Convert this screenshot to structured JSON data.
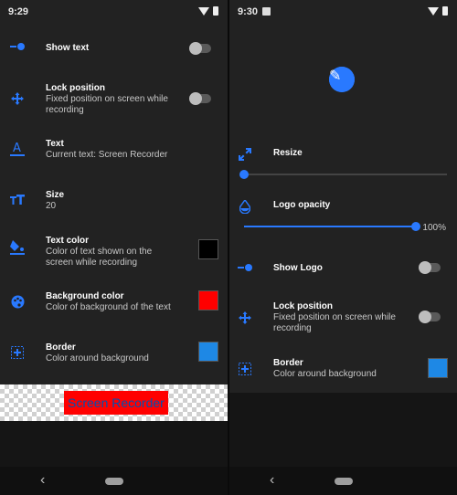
{
  "left": {
    "time": "9:29",
    "items": [
      {
        "title": "Show text",
        "subtitle": ""
      },
      {
        "title": "Lock position",
        "subtitle": "Fixed position on screen while recording"
      },
      {
        "title": "Text",
        "subtitle": "Current text: Screen Recorder"
      },
      {
        "title": "Size",
        "subtitle": "20"
      },
      {
        "title": "Text color",
        "subtitle": "Color of text shown on the screen while recording"
      },
      {
        "title": "Background color",
        "subtitle": "Color of background of the text"
      },
      {
        "title": "Border",
        "subtitle": "Color around background"
      }
    ],
    "swatches": {
      "text_color": "#000000",
      "background_color": "#ff0000",
      "border_color": "#1e88e5"
    },
    "preview_text": "Screen Recorder"
  },
  "right": {
    "time": "9:30",
    "items": [
      {
        "title": "Resize",
        "subtitle": ""
      },
      {
        "title": "Logo opacity",
        "subtitle": ""
      },
      {
        "title": "Show Logo",
        "subtitle": ""
      },
      {
        "title": "Lock position",
        "subtitle": "Fixed position on screen while recording"
      },
      {
        "title": "Border",
        "subtitle": "Color around background"
      }
    ],
    "resize_value": 0,
    "opacity_value": 1.0,
    "opacity_label": "100%",
    "swatches": {
      "border_color": "#1e88e5"
    }
  },
  "nav": {
    "back_icon": "‹"
  },
  "colors": {
    "accent": "#2979ff",
    "panel": "#222222"
  }
}
